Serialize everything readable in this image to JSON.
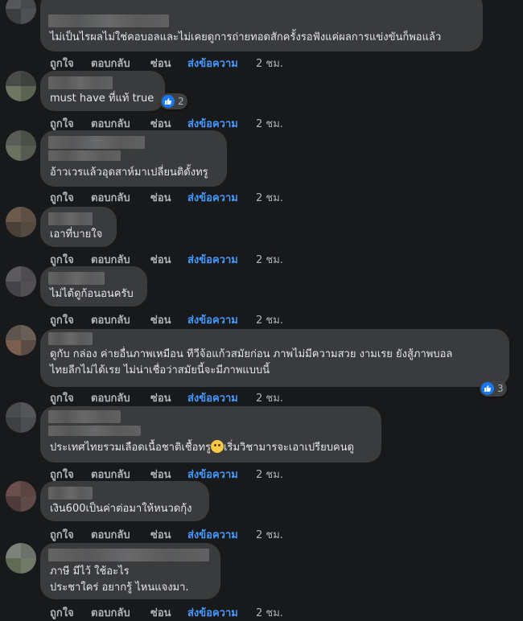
{
  "actions": {
    "like": "ถูกใจ",
    "reply": "ตอบกลับ",
    "hide": "ซ่อน",
    "send_message": "ส่งข้อความ",
    "time": "2 ชม."
  },
  "comments": [
    {
      "lines": [
        "ไม่เป็นไรผลไม่ใช่คอบอลและไม่เคยดูการถ่ายทอดสักครั้งรอฟังแค่ผลการแข่งขันก็พอแล้ว"
      ]
    },
    {
      "lines": [
        "must have ที่แท้ true"
      ],
      "reaction_count": "2"
    },
    {
      "lines": [
        "อ้าวเวรแล้วอุดสาห์มาเปลี่ยนติดั้งทรู"
      ]
    },
    {
      "lines": [
        "เอาที่บายใจ"
      ]
    },
    {
      "lines": [
        "ไม่ได้ดูก้อนอนครับ"
      ]
    },
    {
      "lines": [
        "ดูกับ กล่อง ค่ายอื่นภาพเหมือน ทีวีจ้อแก้วสมัยก่อน ภาพไม่มีความสวย งามเรย ยังสู้ภาพบอล",
        "ไทยลีกไม่ได้เรย ไม่น่าเชื่อว่าสมัยนี้จะมีภาพแบบนี้"
      ],
      "reaction_count": "3"
    },
    {
      "line_before_emoji": "ประเทศไทยรวมเลือดเนื้อชาติเชื้อทรู",
      "line_after_emoji": "เริ่มวิชามารจะเอาเปรียบคนดู"
    },
    {
      "lines": [
        "เงิน600เป็นค่าต่อมาให้หนวดกุ้ง"
      ]
    },
    {
      "lines": [
        "ภาษี มีไว้ ใช้อะไร",
        "ประชาใคร่ อยากรู้ ไหนแจงมา."
      ]
    }
  ],
  "colors": {
    "background": "#18191a",
    "bubble": "#3a3b3c",
    "text": "#e4e6eb",
    "action_text": "#b0b3b8",
    "send_message": "#4599ff",
    "like_badge": "#1877f2"
  },
  "icons": {
    "like": "thumbs-up-icon",
    "emoji": "thinking-face-emoji"
  }
}
